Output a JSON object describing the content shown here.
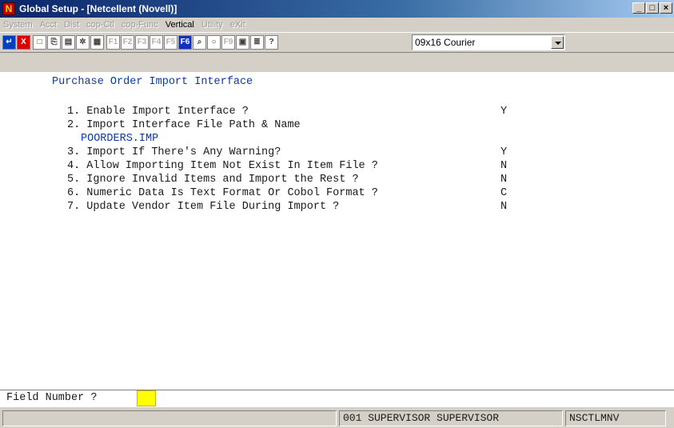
{
  "window": {
    "title": "Global Setup - [Netcellent (Novell)]",
    "app_icon_letter": "N"
  },
  "menu": {
    "items": [
      "System",
      "Acct",
      "Dist",
      "cop-Ctl",
      "cop-Func",
      "Vertical",
      "Utility",
      "eXit"
    ],
    "active_index": 5
  },
  "toolbar": {
    "fkeys": [
      "F1",
      "F2",
      "F3",
      "F4",
      "F5",
      "F6",
      "F9"
    ],
    "active_fkey": "F6",
    "font_value": "09x16 Courier"
  },
  "screen": {
    "heading": "Purchase Order Import Interface",
    "options": [
      {
        "label": "1. Enable Import Interface ?",
        "value": "Y"
      },
      {
        "label": "2. Import Interface File Path & Name",
        "value": ""
      },
      {
        "label": "3. Import If There's Any Warning?",
        "value": "Y"
      },
      {
        "label": "4. Allow Importing Item Not Exist In Item File ?",
        "value": "N"
      },
      {
        "label": "5. Ignore Invalid Items and Import the Rest ?",
        "value": "N"
      },
      {
        "label": "6. Numeric Data Is Text Format Or Cobol Format ?",
        "value": "C"
      },
      {
        "label": "7. Update Vendor Item File During Import ?",
        "value": "N"
      }
    ],
    "file_path": "POORDERS.IMP"
  },
  "prompt": {
    "label": "Field Number ?",
    "value": ""
  },
  "status": {
    "left": "",
    "user": "001 SUPERVISOR SUPERVISOR",
    "station": "NSCTLMNV"
  },
  "colors": {
    "titlebar_start": "#0a246a",
    "input_highlight": "#ffff00",
    "value_blue": "#0a3aa8"
  }
}
